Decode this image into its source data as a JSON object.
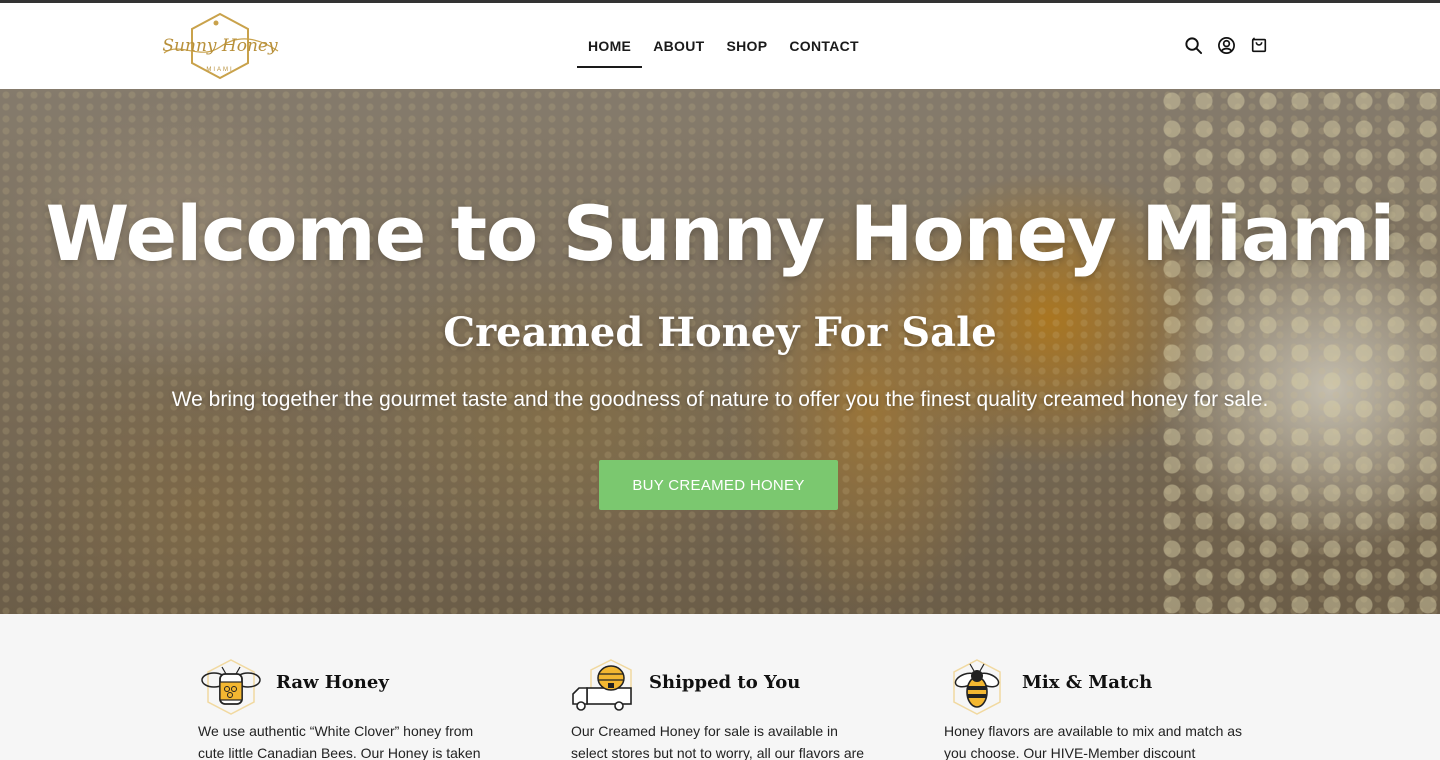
{
  "brand": {
    "logo_text": "Sunny Honey",
    "logo_sub": "MIAMI",
    "gold": "#c9a24b"
  },
  "nav": {
    "items": [
      {
        "label": "HOME",
        "active": true
      },
      {
        "label": "ABOUT",
        "active": false
      },
      {
        "label": "SHOP",
        "active": false
      },
      {
        "label": "CONTACT",
        "active": false
      }
    ]
  },
  "header_icons": [
    "search-icon",
    "account-icon",
    "cart-icon"
  ],
  "hero": {
    "title": "Welcome to Sunny Honey Miami",
    "subtitle": "Creamed Honey For Sale",
    "text": "We bring together the gourmet taste and the goodness of nature to offer you the finest quality creamed honey for sale.",
    "button_label": "BUY CREAMED HONEY",
    "button_color": "#7bc86f"
  },
  "features": [
    {
      "icon": "honey-jar-bee-icon",
      "title": "Raw Honey",
      "text": "We use authentic “White Clover” honey from cute little Canadian Bees. Our Honey is taken"
    },
    {
      "icon": "delivery-truck-hive-icon",
      "title": "Shipped to You",
      "text": "Our Creamed Honey for sale is available in select stores but not to worry, all our flavors are"
    },
    {
      "icon": "bee-icon",
      "title": "Mix & Match",
      "text": "Honey flavors are available to mix and match as you choose. Our HIVE-Member discount"
    }
  ]
}
